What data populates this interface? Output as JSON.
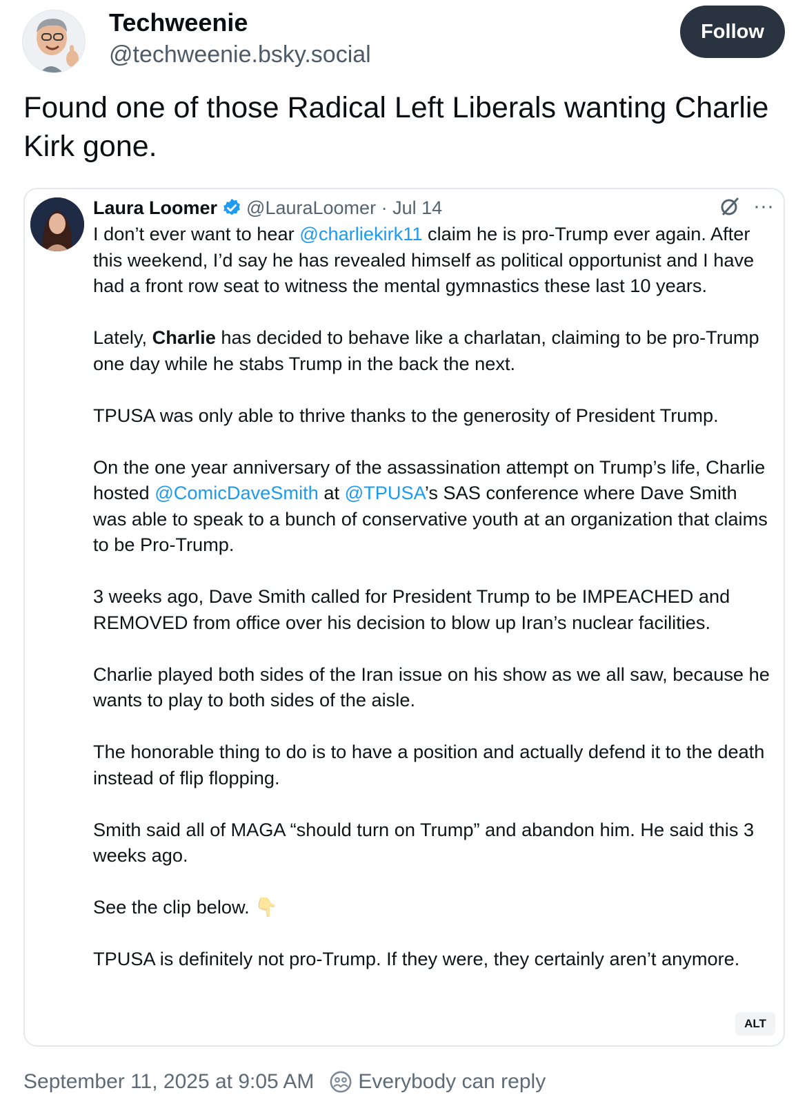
{
  "author": {
    "display_name": "Techweenie",
    "handle": "@techweenie.bsky.social",
    "follow_label": "Follow"
  },
  "post": {
    "text": "Found one of those Radical Left Liberals wanting Charlie Kirk gone."
  },
  "quoted_post": {
    "name": "Laura Loomer",
    "handle": "@LauraLoomer",
    "separator": "·",
    "date": "Jul 14",
    "more_label": "···",
    "alt_label": "ALT",
    "paragraphs": [
      {
        "p1_a": "I don’t ever want to hear ",
        "p1_m1": "@charliekirk11",
        "p1_b": " claim he is pro-Trump ever again. After this weekend, I’d say he has revealed himself as political opportunist and I have had a front row seat to witness the mental gymnastics these last 10 years."
      },
      {
        "p2_a": "Lately, ",
        "p2_bold": "Charlie",
        "p2_b": " has decided to behave like a charlatan, claiming to be pro-Trump one day while he stabs Trump in the back the next."
      },
      {
        "text": "TPUSA was only able to thrive thanks to the generosity of President Trump."
      },
      {
        "p4_a": "On the one year anniversary of the assassination attempt on Trump’s life, Charlie hosted ",
        "p4_m1": "@ComicDaveSmith",
        "p4_b": " at ",
        "p4_m2": "@TPUSA",
        "p4_c": "’s SAS conference where Dave Smith was able to speak to a bunch of conservative youth at an organization that claims to be Pro-Trump."
      },
      {
        "text": "3 weeks ago, Dave Smith called for President Trump to be IMPEACHED and REMOVED from office over his decision to blow up Iran’s nuclear facilities."
      },
      {
        "text": "Charlie played both sides of the Iran issue on his show as we all saw, because he wants to play to both sides of the aisle."
      },
      {
        "text": "The honorable thing to do is to have a position and actually defend it to the death instead of flip flopping."
      },
      {
        "text": "Smith said all of MAGA “should turn on Trump” and abandon him. He said this 3 weeks ago."
      },
      {
        "text": "See the clip below.",
        "emoji": "👇"
      },
      {
        "text": "TPUSA is definitely not pro-Trump. If they were, they certainly aren’t anymore."
      }
    ]
  },
  "footer": {
    "timestamp": "September 11, 2025 at 9:05 AM",
    "reply_setting": "Everybody can reply"
  },
  "colors": {
    "link": "#1d9bf0",
    "follow_bg": "#2a3440",
    "muted": "#5d6b79"
  },
  "icons": [
    "avatar-memoji",
    "verified-badge-icon",
    "grok-icon",
    "more-icon",
    "reply-settings-icon"
  ]
}
